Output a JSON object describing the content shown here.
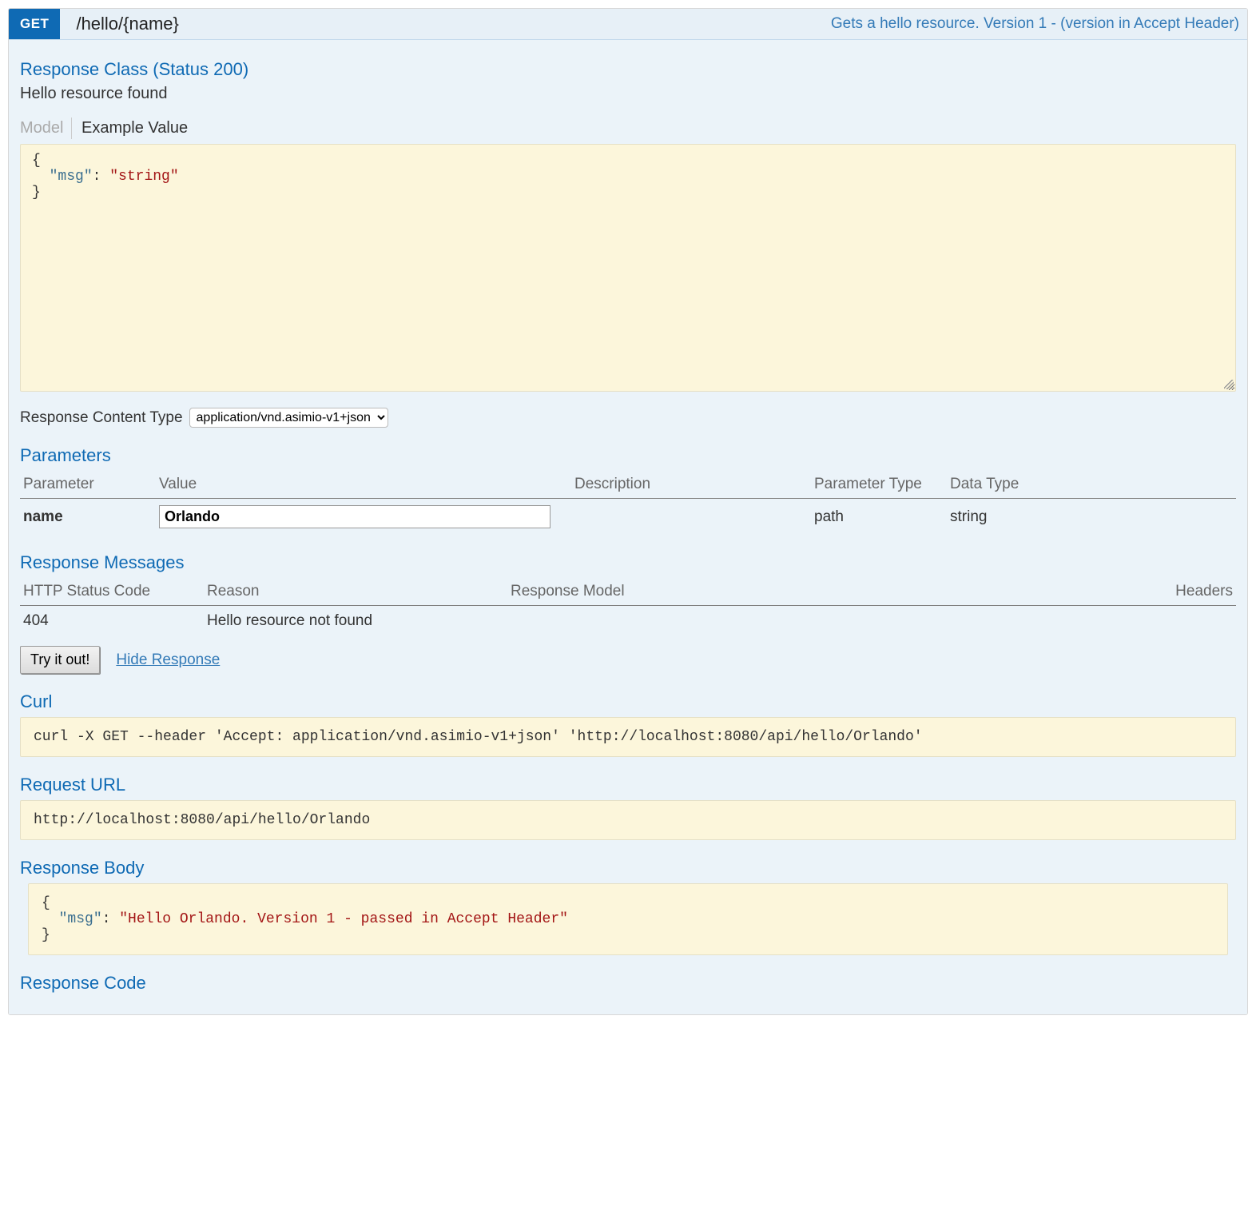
{
  "operation": {
    "method": "GET",
    "path": "/hello/{name}",
    "summary": "Gets a hello resource. Version 1 - (version in Accept Header)"
  },
  "responseClass": {
    "title": "Response Class (Status 200)",
    "description": "Hello resource found",
    "tabs": {
      "model": "Model",
      "example": "Example Value"
    },
    "exampleJsonHtml": "{\n  <span class=\"json-key\">\"msg\"</span>: <span class=\"json-string\">\"string\"</span>\n}"
  },
  "contentType": {
    "label": "Response Content Type",
    "selected": "application/vnd.asimio-v1+json"
  },
  "parameters": {
    "title": "Parameters",
    "headers": {
      "parameter": "Parameter",
      "value": "Value",
      "description": "Description",
      "parameterType": "Parameter Type",
      "dataType": "Data Type"
    },
    "rows": [
      {
        "name": "name",
        "value": "Orlando",
        "description": "",
        "parameterType": "path",
        "dataType": "string"
      }
    ]
  },
  "responseMessages": {
    "title": "Response Messages",
    "headers": {
      "status": "HTTP Status Code",
      "reason": "Reason",
      "model": "Response Model",
      "headers": "Headers"
    },
    "rows": [
      {
        "status": "404",
        "reason": "Hello resource not found",
        "model": "",
        "headers": ""
      }
    ]
  },
  "actions": {
    "tryItOut": "Try it out!",
    "hideResponse": "Hide Response"
  },
  "curl": {
    "title": "Curl",
    "command": "curl -X GET --header 'Accept: application/vnd.asimio-v1+json' 'http://localhost:8080/api/hello/Orlando'"
  },
  "requestUrl": {
    "title": "Request URL",
    "value": "http://localhost:8080/api/hello/Orlando"
  },
  "responseBody": {
    "title": "Response Body",
    "jsonHtml": "{\n  <span class=\"json-key\">\"msg\"</span>: <span class=\"json-string\">\"Hello Orlando. Version 1 - passed in Accept Header\"</span>\n}"
  },
  "responseCode": {
    "title": "Response Code"
  }
}
